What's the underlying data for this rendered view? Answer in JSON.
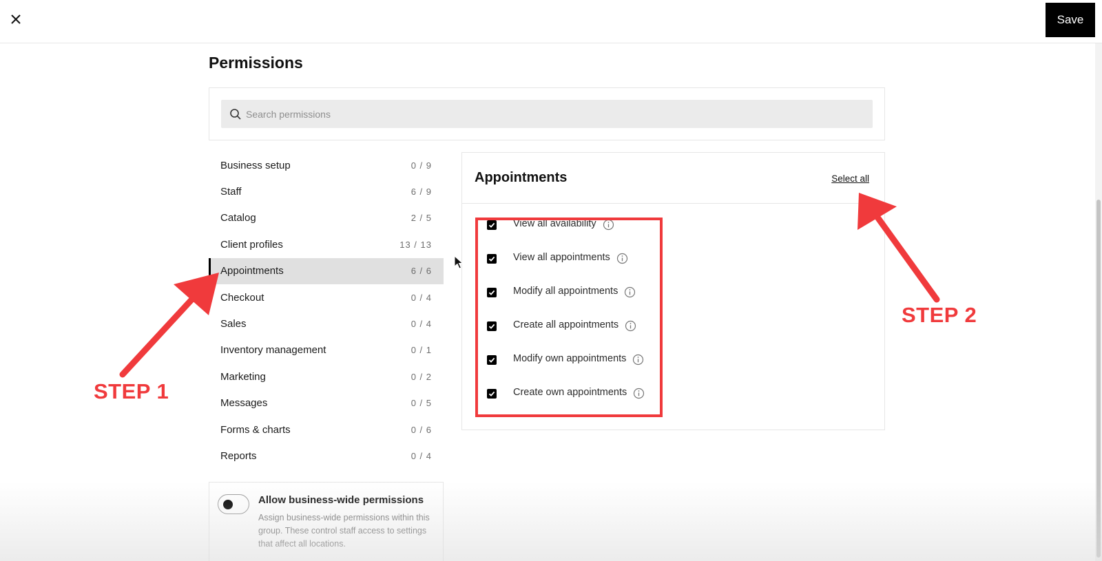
{
  "topbar": {
    "close_icon": "close-icon",
    "save_label": "Save"
  },
  "page": {
    "title": "Permissions"
  },
  "search": {
    "icon": "search-icon",
    "placeholder": "Search permissions",
    "value": ""
  },
  "categories": [
    {
      "label": "Business setup",
      "count": "0 / 9",
      "active": false
    },
    {
      "label": "Staff",
      "count": "6 / 9",
      "active": false
    },
    {
      "label": "Catalog",
      "count": "2 / 5",
      "active": false
    },
    {
      "label": "Client profiles",
      "count": "13 / 13",
      "active": false
    },
    {
      "label": "Appointments",
      "count": "6 / 6",
      "active": true
    },
    {
      "label": "Checkout",
      "count": "0 / 4",
      "active": false
    },
    {
      "label": "Sales",
      "count": "0 / 4",
      "active": false
    },
    {
      "label": "Inventory management",
      "count": "0 / 1",
      "active": false
    },
    {
      "label": "Marketing",
      "count": "0 / 2",
      "active": false
    },
    {
      "label": "Messages",
      "count": "0 / 5",
      "active": false
    },
    {
      "label": "Forms & charts",
      "count": "0 / 6",
      "active": false
    },
    {
      "label": "Reports",
      "count": "0 / 4",
      "active": false
    }
  ],
  "business_wide": {
    "title": "Allow business-wide permissions",
    "description": "Assign business-wide permissions within this group. These control staff access to settings that affect all locations.",
    "enabled": false
  },
  "panel": {
    "title": "Appointments",
    "select_all_label": "Select all",
    "permissions": [
      {
        "label": "View all availability",
        "checked": true,
        "icon": "info-icon"
      },
      {
        "label": "View all appointments",
        "checked": true,
        "icon": "info-icon"
      },
      {
        "label": "Modify all appointments",
        "checked": true,
        "icon": "info-icon"
      },
      {
        "label": "Create all appointments",
        "checked": true,
        "icon": "info-icon"
      },
      {
        "label": "Modify own appointments",
        "checked": true,
        "icon": "info-icon"
      },
      {
        "label": "Create own appointments",
        "checked": true,
        "icon": "info-icon"
      }
    ]
  },
  "annotations": {
    "step1": "STEP 1",
    "step2": "STEP 2",
    "accent_color": "#f03a3c"
  }
}
